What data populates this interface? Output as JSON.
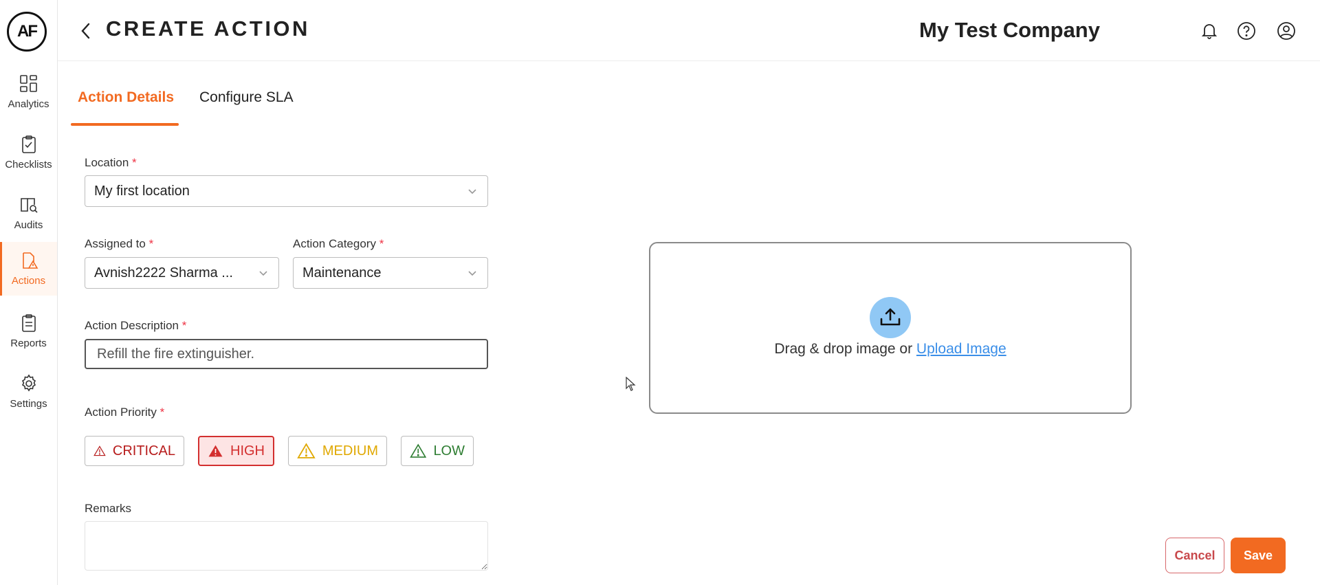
{
  "brand": {
    "logo_text": "AF",
    "accent": "#f26a21"
  },
  "sidebar": {
    "items": [
      {
        "label": "Analytics",
        "icon": "analytics-icon"
      },
      {
        "label": "Checklists",
        "icon": "checklist-icon"
      },
      {
        "label": "Audits",
        "icon": "audit-icon"
      },
      {
        "label": "Actions",
        "icon": "actions-icon",
        "active": true
      },
      {
        "label": "Reports",
        "icon": "reports-icon"
      },
      {
        "label": "Settings",
        "icon": "gear-icon"
      }
    ]
  },
  "header": {
    "title": "CREATE ACTION",
    "company": "My Test Company",
    "icons": [
      "bell-icon",
      "help-icon",
      "user-icon"
    ]
  },
  "tabs": [
    {
      "label": "Action Details",
      "active": true
    },
    {
      "label": "Configure SLA",
      "active": false
    }
  ],
  "form": {
    "location": {
      "label": "Location",
      "required_mark": "*",
      "value": "My first location"
    },
    "assigned_to": {
      "label": "Assigned to",
      "required_mark": "*",
      "value": "Avnish2222 Sharma ..."
    },
    "action_category": {
      "label": "Action Category",
      "required_mark": "*",
      "value": "Maintenance"
    },
    "description": {
      "label": "Action Description",
      "required_mark": "*",
      "value": "Refill the fire extinguisher."
    },
    "priority": {
      "label": "Action Priority",
      "required_mark": "*",
      "options": [
        {
          "label": "CRITICAL",
          "color": "#b71c1c"
        },
        {
          "label": "HIGH",
          "color": "#d32f2f",
          "selected": true
        },
        {
          "label": "MEDIUM",
          "color": "#e0a800"
        },
        {
          "label": "LOW",
          "color": "#2e7d32"
        }
      ]
    },
    "remarks": {
      "label": "Remarks",
      "value": ""
    }
  },
  "upload": {
    "prompt": "Drag & drop image or",
    "link_label": "Upload Image"
  },
  "actions": {
    "cancel_label": "Cancel",
    "save_label": "Save"
  }
}
